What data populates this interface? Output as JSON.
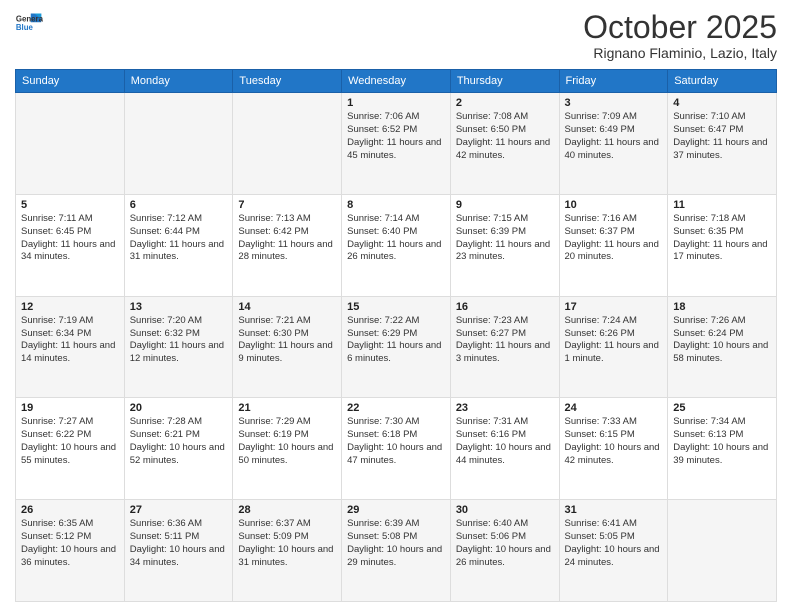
{
  "logo": {
    "line1": "General",
    "line2": "Blue"
  },
  "title": "October 2025",
  "location": "Rignano Flaminio, Lazio, Italy",
  "days_header": [
    "Sunday",
    "Monday",
    "Tuesday",
    "Wednesday",
    "Thursday",
    "Friday",
    "Saturday"
  ],
  "weeks": [
    [
      {
        "num": "",
        "info": ""
      },
      {
        "num": "",
        "info": ""
      },
      {
        "num": "",
        "info": ""
      },
      {
        "num": "1",
        "info": "Sunrise: 7:06 AM\nSunset: 6:52 PM\nDaylight: 11 hours and 45 minutes."
      },
      {
        "num": "2",
        "info": "Sunrise: 7:08 AM\nSunset: 6:50 PM\nDaylight: 11 hours and 42 minutes."
      },
      {
        "num": "3",
        "info": "Sunrise: 7:09 AM\nSunset: 6:49 PM\nDaylight: 11 hours and 40 minutes."
      },
      {
        "num": "4",
        "info": "Sunrise: 7:10 AM\nSunset: 6:47 PM\nDaylight: 11 hours and 37 minutes."
      }
    ],
    [
      {
        "num": "5",
        "info": "Sunrise: 7:11 AM\nSunset: 6:45 PM\nDaylight: 11 hours and 34 minutes."
      },
      {
        "num": "6",
        "info": "Sunrise: 7:12 AM\nSunset: 6:44 PM\nDaylight: 11 hours and 31 minutes."
      },
      {
        "num": "7",
        "info": "Sunrise: 7:13 AM\nSunset: 6:42 PM\nDaylight: 11 hours and 28 minutes."
      },
      {
        "num": "8",
        "info": "Sunrise: 7:14 AM\nSunset: 6:40 PM\nDaylight: 11 hours and 26 minutes."
      },
      {
        "num": "9",
        "info": "Sunrise: 7:15 AM\nSunset: 6:39 PM\nDaylight: 11 hours and 23 minutes."
      },
      {
        "num": "10",
        "info": "Sunrise: 7:16 AM\nSunset: 6:37 PM\nDaylight: 11 hours and 20 minutes."
      },
      {
        "num": "11",
        "info": "Sunrise: 7:18 AM\nSunset: 6:35 PM\nDaylight: 11 hours and 17 minutes."
      }
    ],
    [
      {
        "num": "12",
        "info": "Sunrise: 7:19 AM\nSunset: 6:34 PM\nDaylight: 11 hours and 14 minutes."
      },
      {
        "num": "13",
        "info": "Sunrise: 7:20 AM\nSunset: 6:32 PM\nDaylight: 11 hours and 12 minutes."
      },
      {
        "num": "14",
        "info": "Sunrise: 7:21 AM\nSunset: 6:30 PM\nDaylight: 11 hours and 9 minutes."
      },
      {
        "num": "15",
        "info": "Sunrise: 7:22 AM\nSunset: 6:29 PM\nDaylight: 11 hours and 6 minutes."
      },
      {
        "num": "16",
        "info": "Sunrise: 7:23 AM\nSunset: 6:27 PM\nDaylight: 11 hours and 3 minutes."
      },
      {
        "num": "17",
        "info": "Sunrise: 7:24 AM\nSunset: 6:26 PM\nDaylight: 11 hours and 1 minute."
      },
      {
        "num": "18",
        "info": "Sunrise: 7:26 AM\nSunset: 6:24 PM\nDaylight: 10 hours and 58 minutes."
      }
    ],
    [
      {
        "num": "19",
        "info": "Sunrise: 7:27 AM\nSunset: 6:22 PM\nDaylight: 10 hours and 55 minutes."
      },
      {
        "num": "20",
        "info": "Sunrise: 7:28 AM\nSunset: 6:21 PM\nDaylight: 10 hours and 52 minutes."
      },
      {
        "num": "21",
        "info": "Sunrise: 7:29 AM\nSunset: 6:19 PM\nDaylight: 10 hours and 50 minutes."
      },
      {
        "num": "22",
        "info": "Sunrise: 7:30 AM\nSunset: 6:18 PM\nDaylight: 10 hours and 47 minutes."
      },
      {
        "num": "23",
        "info": "Sunrise: 7:31 AM\nSunset: 6:16 PM\nDaylight: 10 hours and 44 minutes."
      },
      {
        "num": "24",
        "info": "Sunrise: 7:33 AM\nSunset: 6:15 PM\nDaylight: 10 hours and 42 minutes."
      },
      {
        "num": "25",
        "info": "Sunrise: 7:34 AM\nSunset: 6:13 PM\nDaylight: 10 hours and 39 minutes."
      }
    ],
    [
      {
        "num": "26",
        "info": "Sunrise: 6:35 AM\nSunset: 5:12 PM\nDaylight: 10 hours and 36 minutes."
      },
      {
        "num": "27",
        "info": "Sunrise: 6:36 AM\nSunset: 5:11 PM\nDaylight: 10 hours and 34 minutes."
      },
      {
        "num": "28",
        "info": "Sunrise: 6:37 AM\nSunset: 5:09 PM\nDaylight: 10 hours and 31 minutes."
      },
      {
        "num": "29",
        "info": "Sunrise: 6:39 AM\nSunset: 5:08 PM\nDaylight: 10 hours and 29 minutes."
      },
      {
        "num": "30",
        "info": "Sunrise: 6:40 AM\nSunset: 5:06 PM\nDaylight: 10 hours and 26 minutes."
      },
      {
        "num": "31",
        "info": "Sunrise: 6:41 AM\nSunset: 5:05 PM\nDaylight: 10 hours and 24 minutes."
      },
      {
        "num": "",
        "info": ""
      }
    ]
  ]
}
